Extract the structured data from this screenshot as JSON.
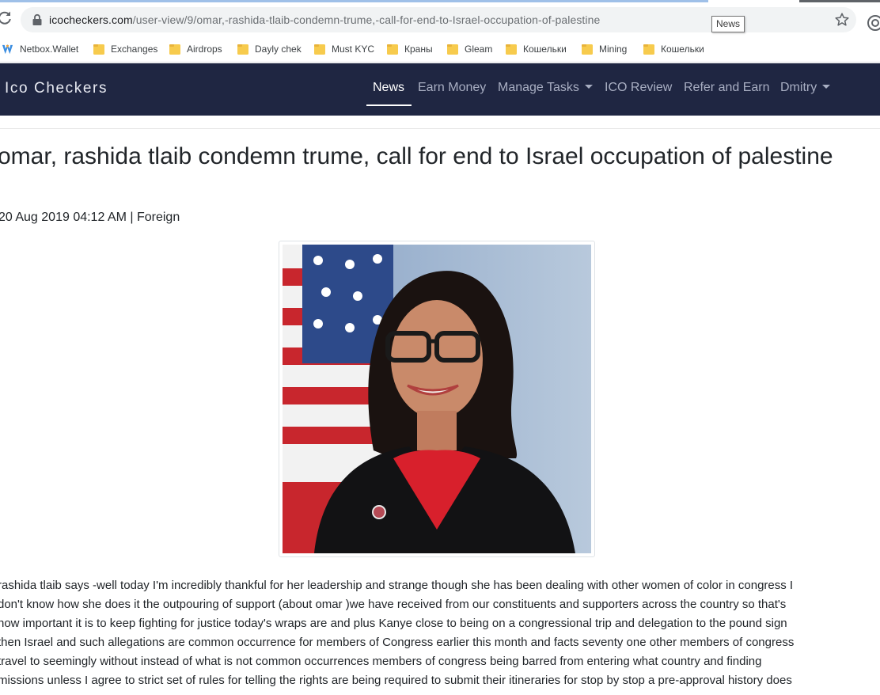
{
  "browser": {
    "url_domain": "icocheckers.com",
    "url_path": "/user-view/9/omar,-rashida-tlaib-condemn-trume,-call-for-end-to-Israel-occupation-of-palestine",
    "tooltip": "News"
  },
  "bookmarks": [
    {
      "label": "Netbox.Wallet",
      "icon": "netbox-icon"
    },
    {
      "label": "Exchanges",
      "icon": "folder-icon"
    },
    {
      "label": "Airdrops",
      "icon": "folder-icon"
    },
    {
      "label": "Dayly chek",
      "icon": "folder-icon"
    },
    {
      "label": "Must KYC",
      "icon": "folder-icon"
    },
    {
      "label": "Краны",
      "icon": "folder-icon"
    },
    {
      "label": "Gleam",
      "icon": "folder-icon"
    },
    {
      "label": "Кошельки",
      "icon": "folder-icon"
    },
    {
      "label": "Mining",
      "icon": "folder-icon"
    },
    {
      "label": "Кошельки",
      "icon": "folder-icon"
    }
  ],
  "navbar": {
    "brand": "Ico Checkers",
    "items": [
      {
        "label": "News",
        "active": true,
        "dropdown": false
      },
      {
        "label": "Earn Money",
        "active": false,
        "dropdown": false
      },
      {
        "label": "Manage Tasks",
        "active": false,
        "dropdown": true
      },
      {
        "label": "ICO Review",
        "active": false,
        "dropdown": false
      },
      {
        "label": "Refer and Earn",
        "active": false,
        "dropdown": false
      },
      {
        "label": "Dmitry",
        "active": false,
        "dropdown": true
      }
    ]
  },
  "article": {
    "title": "omar, rashida tlaib condemn trume, call for end to Israel occupation of palestine",
    "meta": "20 Aug 2019 04:12 AM | Foreign",
    "body_lines": [
      "rashida tlaib says -well today I'm incredibly thankful for her leadership and strange though she has been dealing with other women of color in congress I",
      "don't know how she does it the outpouring of support (about omar )we have received from our constituents and supporters across the country so that's",
      "how important it is to keep fighting for justice today's wraps are and plus Kanye close to being on a congressional trip and delegation to the pound sign",
      "then Israel and such allegations are common occurrence for members of Congress earlier this month and facts seventy one other members of congress",
      "travel to seemingly without instead of what is not common occurrences members of congress being barred from entering what country and finding",
      "missions unless I agree to strict set of rules for telling the rights are being required to submit their itineraries for stop by stop a pre-approval history does"
    ]
  },
  "colors": {
    "navbar_bg": "#1f2642",
    "nav_active": "#ffffff",
    "nav_inactive": "#a8aec2",
    "text": "#212529",
    "folder": "#f7cb4d"
  }
}
